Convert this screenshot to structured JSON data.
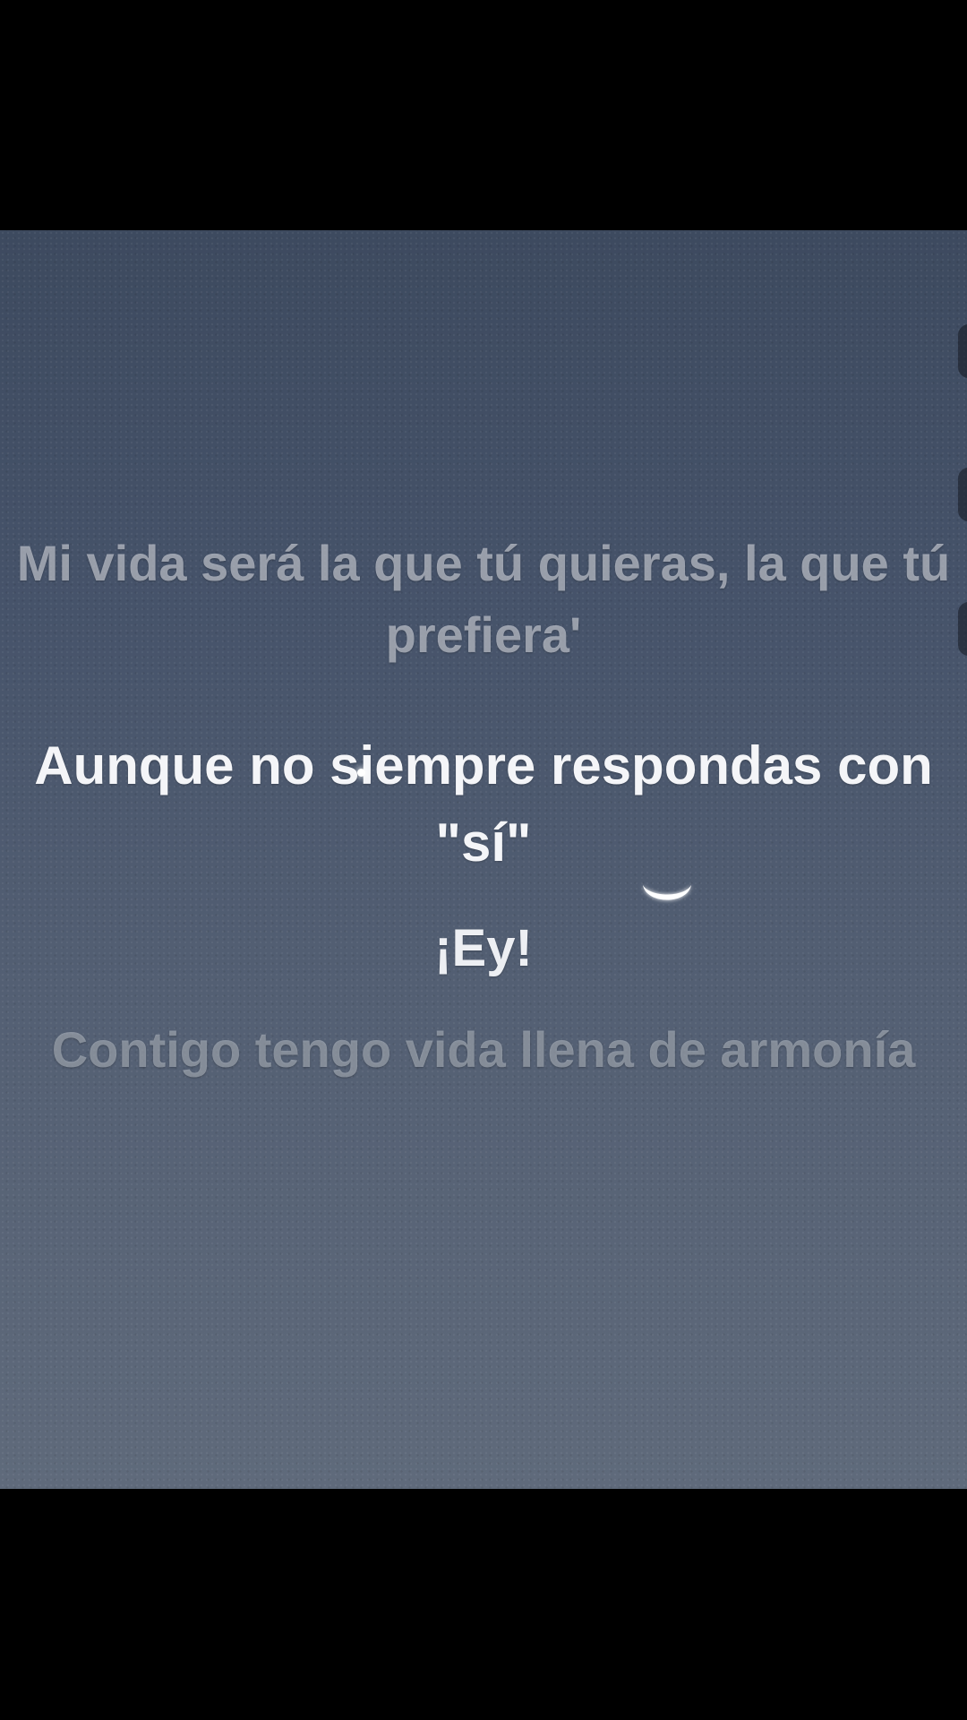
{
  "lyrics": {
    "previous": "Mi vida será la que tú quieras, la que tú prefiera'",
    "current": "Aunque no siempre respondas con \"sí\"",
    "next_a": "¡Ey!",
    "next_b": "Contigo tengo vida llena de armonía"
  },
  "icons": {
    "moon": "crescent-moon-icon"
  },
  "colors": {
    "sky_top": "#3d4a5f",
    "sky_bottom": "#5f6a7b",
    "active_text": "#f4f5f8",
    "faded_text": "#d6dae2"
  }
}
